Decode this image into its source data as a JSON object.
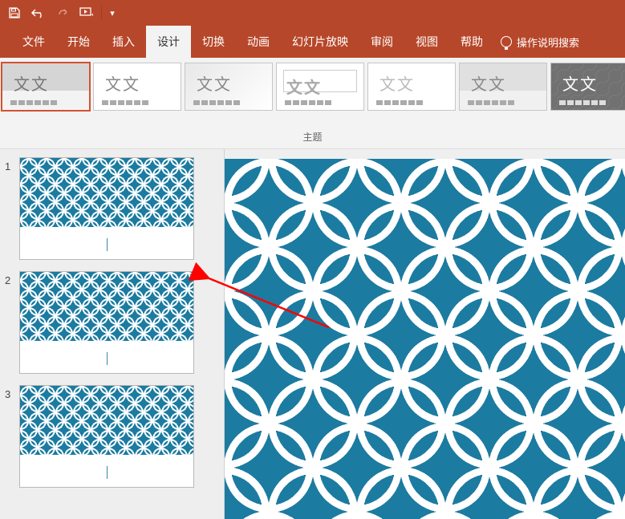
{
  "titlebar": {
    "save_tt": "保存",
    "undo_tt": "撤销",
    "redo_tt": "重做",
    "start_tt": "从头开始"
  },
  "tabs": {
    "file": "文件",
    "home": "开始",
    "insert": "插入",
    "design": "设计",
    "transitions": "切换",
    "animations": "动画",
    "slideshow": "幻灯片放映",
    "review": "审阅",
    "view": "视图",
    "help": "帮助",
    "tellme": "操作说明搜索"
  },
  "ribbon": {
    "aa": "文文",
    "themes_label": "主题"
  },
  "slides": {
    "n1": "1",
    "n2": "2",
    "n3": "3"
  }
}
